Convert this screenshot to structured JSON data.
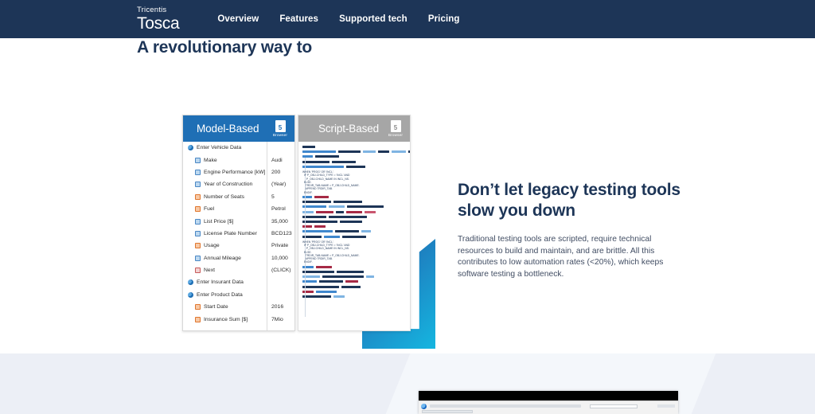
{
  "nav": {
    "brand_sup": "Tricentis",
    "brand_main": "Tosca",
    "links": [
      {
        "label": "Overview"
      },
      {
        "label": "Features"
      },
      {
        "label": "Supported tech"
      },
      {
        "label": "Pricing"
      }
    ]
  },
  "hero": {
    "title": "Don’t let legacy testing tools slow you down",
    "paragraph": "Traditional testing tools are scripted, require technical resources to build and maintain, and are brittle. All this contributes to low automation rates (<20%), which keeps software testing a bottleneck.",
    "model_card": {
      "title": "Model-Based",
      "badge_label": "Browser",
      "badge_glyph": "5",
      "rows": [
        {
          "label": "Enter Vehicle Data",
          "value": "",
          "level": 0,
          "icon": "group"
        },
        {
          "label": "Make",
          "value": "Audi",
          "level": 1,
          "icon": "input"
        },
        {
          "label": "Engine Performance [kW]",
          "value": "200",
          "level": 1,
          "icon": "input"
        },
        {
          "label": "Year of Construction",
          "value": "(Year)",
          "level": 1,
          "icon": "input"
        },
        {
          "label": "Number of Seats",
          "value": "5",
          "level": 1,
          "icon": "select"
        },
        {
          "label": "Fuel",
          "value": "Petrol",
          "level": 1,
          "icon": "select"
        },
        {
          "label": "List Price [$]",
          "value": "35,000",
          "level": 1,
          "icon": "input"
        },
        {
          "label": "License Plate Number",
          "value": "BCD123",
          "level": 1,
          "icon": "input"
        },
        {
          "label": "Usage",
          "value": "Private",
          "level": 1,
          "icon": "select"
        },
        {
          "label": "Annual Mileage",
          "value": "10,000",
          "level": 1,
          "icon": "input"
        },
        {
          "label": "Next",
          "value": "(CLICK)",
          "level": 1,
          "icon": "click"
        },
        {
          "label": "Enter Insurant Data",
          "value": "",
          "level": 0,
          "icon": "group"
        },
        {
          "label": "Enter Product Data",
          "value": "",
          "level": 0,
          "icon": "group"
        },
        {
          "label": "Start Date",
          "value": "2016",
          "level": 1,
          "icon": "select"
        },
        {
          "label": "Insurance Sum [$]",
          "value": "7Mio",
          "level": 1,
          "icon": "select"
        }
      ]
    },
    "script_card": {
      "title": "Script-Based",
      "badge_label": "Browser",
      "badge_glyph": "5",
      "code_snippet": "WHEN 'PROG' OR 'INCL'.\n  IF P_OBJ-CHILD_TYPE = 'INCL' AND\n     P_OBJ-CHILD_NAME IN INCL_NS.\n  ELSE.\n    TRDIR_TAB-NAME = P_OBJ-CHILD_NAME.\n    APPEND TRDIR_TAB.\n  ENDIF."
    }
  },
  "lower": {
    "title": "A revolutionary way to"
  },
  "colors": {
    "nav_background": "#1d3557",
    "model_header": "#1f6fb5",
    "script_header": "#a6a6a6",
    "accent_start": "#1c63a8",
    "accent_end": "#15b6e0",
    "heading": "#1d3557",
    "lower_background": "#f4f7fb"
  }
}
